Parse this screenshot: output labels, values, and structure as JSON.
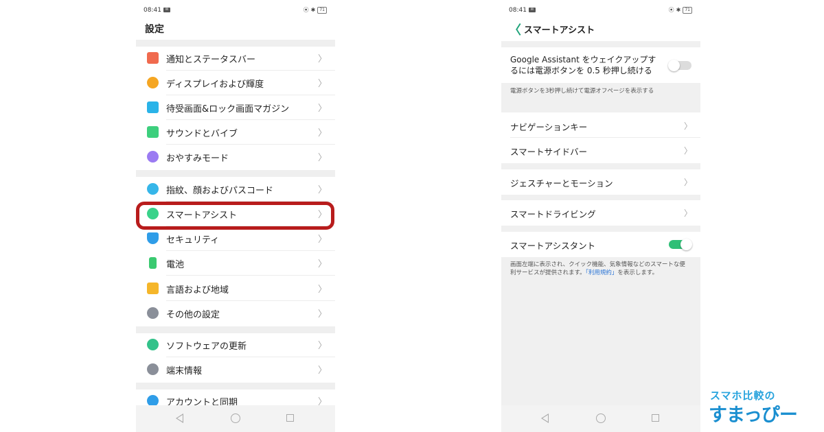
{
  "left_screen": {
    "status": {
      "time": "08:41",
      "battery": "71"
    },
    "title": "設定",
    "rows": [
      {
        "label": "通知とステータスバー",
        "icon": "notification-icon",
        "color": "#f06a4e"
      },
      {
        "label": "ディスプレイおよび輝度",
        "icon": "display-icon",
        "color": "#f5a623"
      },
      {
        "label": "待受画面&ロック画面マガジン",
        "icon": "wallpaper-icon",
        "color": "#2ab3e8"
      },
      {
        "label": "サウンドとバイブ",
        "icon": "sound-icon",
        "color": "#3dcf7d"
      },
      {
        "label": "おやすみモード",
        "icon": "moon-icon",
        "color": "#9b7bf2"
      },
      {
        "label": "指紋、顔およびパスコード",
        "icon": "fingerprint-icon",
        "color": "#36b6e9"
      },
      {
        "label": "スマートアシスト",
        "icon": "smart-assist-icon",
        "color": "#3ad28a"
      },
      {
        "label": "セキュリティ",
        "icon": "shield-icon",
        "color": "#2f9de8"
      },
      {
        "label": "電池",
        "icon": "battery-icon",
        "color": "#3ac970"
      },
      {
        "label": "言語および地域",
        "icon": "language-icon",
        "color": "#f5b62a"
      },
      {
        "label": "その他の設定",
        "icon": "gear-icon",
        "color": "#8a8f99"
      },
      {
        "label": "ソフトウェアの更新",
        "icon": "update-icon",
        "color": "#33c28a"
      },
      {
        "label": "端末情報",
        "icon": "info-icon",
        "color": "#8a8f99"
      },
      {
        "label": "アカウントと同期",
        "icon": "account-icon",
        "color": "#2f9de8"
      }
    ],
    "chevron": "〉"
  },
  "right_screen": {
    "status": {
      "time": "08:41",
      "battery": "71"
    },
    "title": "スマートアシスト",
    "back": "〈",
    "google_label": "Google Assistant をウェイクアップするには電源ボタンを 0.5 秒押し続ける",
    "google_toggle": "off",
    "power_note": "電源ボタンを3秒押し続けて電源オフページを表示する",
    "rows": {
      "navigation": "ナビゲーションキー",
      "sidebar": "スマートサイドバー",
      "gesture": "ジェスチャーとモーション",
      "driving": "スマートドライビング",
      "assistant": "スマートアシスタント"
    },
    "assistant_toggle": "on",
    "assistant_note_pre": "画面左端に表示され、クイック機能、気象情報などのスマートな便利サービスが提供されます。",
    "assistant_note_link": "「利用規約」",
    "assistant_note_post": "を表示します。",
    "chevron": "〉"
  },
  "logo": {
    "top": "スマホ比較の",
    "main": "すまっぴー"
  }
}
